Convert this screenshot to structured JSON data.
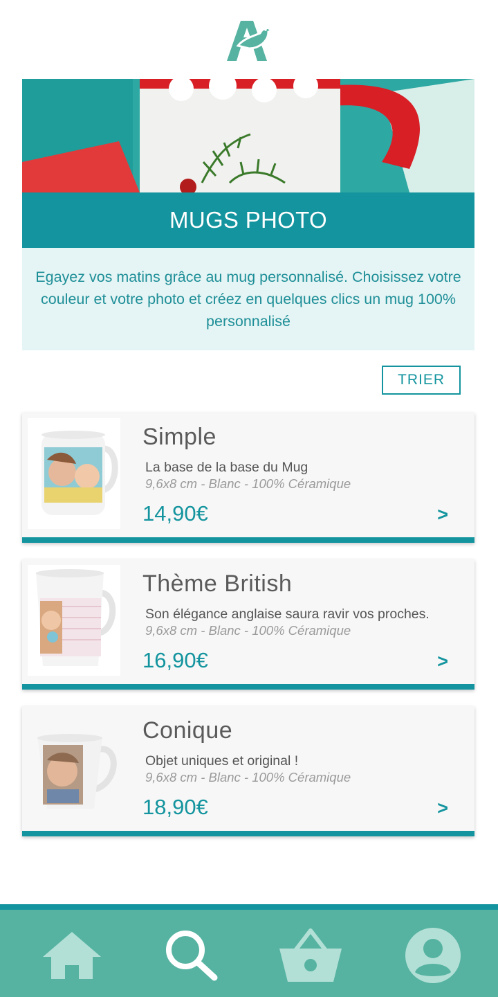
{
  "brand": {
    "logo_icon": "auchan-bird-logo-icon",
    "color": "#56b3a1"
  },
  "hero": {
    "image": "mug-with-marshmallows-photo"
  },
  "category": {
    "title": "MUGS PHOTO",
    "description": "Egayez vos matins grâce au mug personnalisé. Choisissez votre couleur et votre photo et créez en quelques clics un mug 100% personnalisé"
  },
  "sort": {
    "label": "TRIER"
  },
  "products": [
    {
      "name": "Simple",
      "description": "La base de la base du Mug",
      "spec": "9,6x8 cm - Blanc - 100% Céramique",
      "price": "14,90€",
      "chevron": ">"
    },
    {
      "name": "Thème British",
      "description": "Son élégance anglaise saura ravir vos proches.",
      "spec": "9,6x8 cm - Blanc - 100% Céramique",
      "price": "16,90€",
      "chevron": ">"
    },
    {
      "name": "Conique",
      "description": "Objet uniques et original !",
      "spec": "9,6x8 cm - Blanc - 100% Céramique",
      "price": "18,90€",
      "chevron": ">"
    }
  ],
  "nav": {
    "items": [
      {
        "icon": "home-icon",
        "active": false
      },
      {
        "icon": "search-icon",
        "active": true
      },
      {
        "icon": "basket-icon",
        "active": false
      },
      {
        "icon": "account-icon",
        "active": false
      }
    ]
  },
  "colors": {
    "primary": "#13949e",
    "nav_bg": "#56b3a1",
    "nav_icon": "#b3e0d6",
    "nav_active": "#ffffff",
    "intro_bg": "#e5f4f4"
  }
}
